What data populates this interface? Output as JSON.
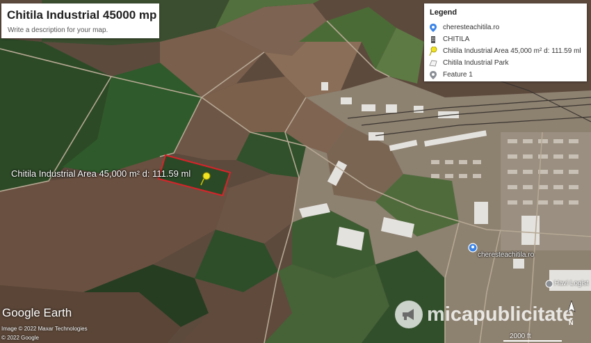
{
  "title": {
    "name": "Chitila Industrial 45000 mp",
    "description": "Write a description for your map."
  },
  "legend": {
    "heading": "Legend",
    "items": [
      {
        "label": "cheresteachitila.ro",
        "icon": "location-pin-icon"
      },
      {
        "label": "CHITILA",
        "icon": "building-icon"
      },
      {
        "label": "Chitila Industrial Area 45,000 m² d: 111.59 ml",
        "icon": "yellow-pushpin-icon"
      },
      {
        "label": "Chitila Industrial Park",
        "icon": "polygon-icon"
      },
      {
        "label": "Feature 1",
        "icon": "grey-pin-icon"
      }
    ]
  },
  "map": {
    "parcel_label": "Chitila Industrial Area 45,000 m² d: 111.59 ml",
    "site_label": "cheresteachitila.ro",
    "havi_label": "Havi Logist",
    "attribution": {
      "logo": "Google Earth",
      "imagery": "Image © 2022 Maxar Technologies",
      "copyright": "© 2022 Google"
    },
    "watermark": "micapublicitate",
    "scale": "2000 ft",
    "compass": "N",
    "colors": {
      "parcel_outline": "#d8232a",
      "pushpin": "#f1e322",
      "site_pin": "#3b83e6"
    }
  }
}
